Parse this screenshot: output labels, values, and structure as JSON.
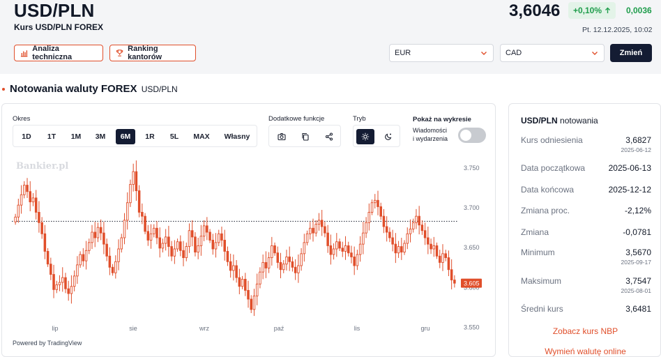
{
  "header": {
    "pair": "USD/PLN",
    "subtitle": "Kurs USD/PLN FOREX",
    "price": "3,6046",
    "change_pct": "+0,10%",
    "change_abs": "0,0036",
    "datetime": "Pt. 12.12.2025, 10:02",
    "btn_tech": "Analiza techniczna",
    "btn_ranking": "Ranking kantorów",
    "select_from": "EUR",
    "select_to": "CAD",
    "btn_change": "Zmień"
  },
  "section": {
    "title": "Notowania waluty FOREX",
    "pair": "USD/PLN"
  },
  "chart_controls": {
    "okres_label": "Okres",
    "periods": [
      "1D",
      "1T",
      "1M",
      "3M",
      "6M",
      "1R",
      "5L",
      "MAX",
      "Własny"
    ],
    "active_period": "6M",
    "functions_label": "Dodatkowe funkcje",
    "mode_label": "Tryb",
    "show_label": "Pokaż na wykresie",
    "show_sub1": "Wiadomości",
    "show_sub2": "i wydarzenia",
    "watermark": "Bankier.pl",
    "powered": "Powered by TradingView"
  },
  "colors": {
    "accent": "#e04e2a",
    "dark": "#141c33",
    "positive": "#1f9d4c",
    "bg": "#f4f5f7"
  },
  "icons": [
    "chart-bars-icon",
    "trophy-icon",
    "chevron-down-icon",
    "camera-icon",
    "copy-icon",
    "share-icon",
    "sun-icon",
    "moon-icon",
    "arrow-up-icon"
  ],
  "chart_data": {
    "type": "candlestick",
    "x_tick_labels": [
      "lip",
      "sie",
      "wrz",
      "paź",
      "lis",
      "gru"
    ],
    "y_tick_labels": [
      "3.750",
      "3.700",
      "3.650",
      "3.600",
      "3.550"
    ],
    "ylim": [
      3.55,
      3.76
    ],
    "reference_line": 3.6827,
    "last_price_label": "3.605",
    "last_price": 3.605,
    "close": [
      3.688,
      3.703,
      3.716,
      3.728,
      3.72,
      3.707,
      3.712,
      3.694,
      3.681,
      3.667,
      3.645,
      3.629,
      3.616,
      3.597,
      3.603,
      3.606,
      3.612,
      3.598,
      3.592,
      3.601,
      3.614,
      3.628,
      3.641,
      3.633,
      3.646,
      3.656,
      3.669,
      3.662,
      3.675,
      3.668,
      3.654,
      3.639,
      3.625,
      3.618,
      3.632,
      3.648,
      3.662,
      3.684,
      3.706,
      3.729,
      3.745,
      3.721,
      3.694,
      3.689,
      3.67,
      3.659,
      3.667,
      3.674,
      3.662,
      3.649,
      3.655,
      3.663,
      3.651,
      3.639,
      3.648,
      3.657,
      3.646,
      3.637,
      3.651,
      3.671,
      3.663,
      3.644,
      3.652,
      3.664,
      3.677,
      3.669,
      3.659,
      3.648,
      3.656,
      3.667,
      3.659,
      3.645,
      3.632,
      3.621,
      3.627,
      3.612,
      3.601,
      3.61,
      3.596,
      3.585,
      3.572,
      3.589,
      3.604,
      3.619,
      3.631,
      3.624,
      3.637,
      3.652,
      3.643,
      3.631,
      3.622,
      3.629,
      3.638,
      3.632,
      3.625,
      3.618,
      3.627,
      3.642,
      3.656,
      3.667,
      3.674,
      3.668,
      3.679,
      3.684,
      3.676,
      3.668,
      3.652,
      3.641,
      3.648,
      3.657,
      3.649,
      3.645,
      3.652,
      3.643,
      3.638,
      3.627,
      3.641,
      3.654,
      3.668,
      3.681,
      3.694,
      3.706,
      3.709,
      3.701,
      3.689,
      3.676,
      3.669,
      3.662,
      3.654,
      3.643,
      3.651,
      3.644,
      3.655,
      3.667,
      3.673,
      3.681,
      3.689,
      3.678,
      3.671,
      3.662,
      3.654,
      3.648,
      3.652,
      3.639,
      3.631,
      3.642,
      3.637,
      3.622,
      3.609,
      3.605
    ]
  },
  "stats": {
    "title_bold": "USD/PLN",
    "title_rest": "notowania",
    "ref_label": "Kurs odniesienia",
    "ref_val": "3,6827",
    "ref_date": "2025-06-12",
    "start_label": "Data początkowa",
    "start_val": "2025-06-13",
    "end_label": "Data końcowa",
    "end_val": "2025-12-12",
    "pct_label": "Zmiana proc.",
    "pct_val": "-2,12%",
    "chg_label": "Zmiana",
    "chg_val": "-0,0781",
    "min_label": "Minimum",
    "min_val": "3,5670",
    "min_date": "2025-09-17",
    "max_label": "Maksimum",
    "max_val": "3,7547",
    "max_date": "2025-08-01",
    "avg_label": "Średni kurs",
    "avg_val": "3,6481",
    "link_nbp": "Zobacz kurs NBP",
    "link_exchange": "Wymień walutę online"
  }
}
